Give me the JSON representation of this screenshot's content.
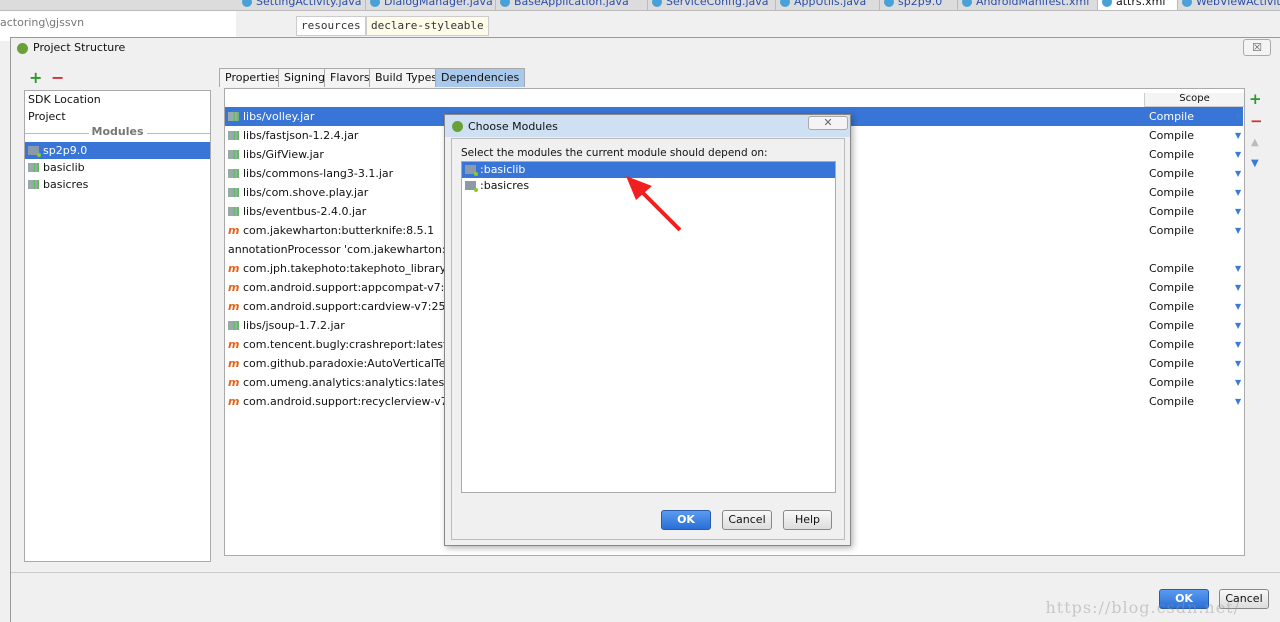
{
  "editor_tabs": [
    {
      "label": "SettingActivity.java"
    },
    {
      "label": "DialogManager.java"
    },
    {
      "label": "BaseApplication.java"
    },
    {
      "label": "ServiceConfig.java"
    },
    {
      "label": "AppUtils.java"
    },
    {
      "label": "sp2p9.0"
    },
    {
      "label": "AndroidManifest.xml"
    },
    {
      "label": "attrs.xml"
    },
    {
      "label": "WebViewActivity.java"
    }
  ],
  "path_text": "actoring\\gjssvn",
  "breadcrumbs": [
    "resources",
    "declare-styleable"
  ],
  "dialog": {
    "title": "Project Structure",
    "close": "☒",
    "left": {
      "add": "+",
      "remove": "−",
      "items": [
        "SDK Location",
        "Project"
      ],
      "modules_header": "Modules",
      "modules": [
        {
          "label": "sp2p9.0",
          "selected": true
        },
        {
          "label": "basiclib"
        },
        {
          "label": "basicres"
        }
      ]
    },
    "tabs": [
      "Properties",
      "Signing",
      "Flavors",
      "Build Types",
      "Dependencies"
    ],
    "active_tab": "Dependencies",
    "scope_header": "Scope",
    "dependencies": [
      {
        "name": "libs/volley.jar",
        "type": "jar",
        "scope": "Compile"
      },
      {
        "name": "libs/fastjson-1.2.4.jar",
        "type": "jar",
        "scope": "Compile"
      },
      {
        "name": "libs/GifView.jar",
        "type": "jar",
        "scope": "Compile"
      },
      {
        "name": "libs/commons-lang3-3.1.jar",
        "type": "jar",
        "scope": "Compile"
      },
      {
        "name": "libs/com.shove.play.jar",
        "type": "jar",
        "scope": "Compile"
      },
      {
        "name": "libs/eventbus-2.4.0.jar",
        "type": "jar",
        "scope": "Compile"
      },
      {
        "name": "com.jakewharton:butterknife:8.5.1",
        "type": "maven",
        "scope": "Compile"
      },
      {
        "name": "annotationProcessor 'com.jakewharton:butterknife-compiler:8.5.1'",
        "type": "none",
        "scope": ""
      },
      {
        "name": "com.jph.takephoto:takephoto_library:4.0.2",
        "type": "maven",
        "scope": "Compile"
      },
      {
        "name": "com.android.support:appcompat-v7:25.3.1",
        "type": "maven",
        "scope": "Compile"
      },
      {
        "name": "com.android.support:cardview-v7:25.3.1",
        "type": "maven",
        "scope": "Compile"
      },
      {
        "name": "libs/jsoup-1.7.2.jar",
        "type": "jar",
        "scope": "Compile"
      },
      {
        "name": "com.tencent.bugly:crashreport:latest.release",
        "type": "maven",
        "scope": "Compile"
      },
      {
        "name": "com.github.paradoxie:AutoVerticalTextview",
        "type": "maven",
        "scope": "Compile"
      },
      {
        "name": "com.umeng.analytics:analytics:latest.integration",
        "type": "maven",
        "scope": "Compile"
      },
      {
        "name": "com.android.support:recyclerview-v7:25.3.1",
        "type": "maven",
        "scope": "Compile"
      }
    ],
    "toolbar": {
      "add": "+",
      "remove": "−",
      "up": "▲",
      "down": "▼"
    },
    "ok": "OK",
    "cancel": "Cancel"
  },
  "choose": {
    "title": "Choose Modules",
    "close": "✕",
    "prompt": "Select the modules the current module should depend on:",
    "modules": [
      ":basiclib",
      ":basicres"
    ],
    "ok": "OK",
    "cancel": "Cancel",
    "help": "Help"
  },
  "watermark": "https://blog.csdn.net/"
}
